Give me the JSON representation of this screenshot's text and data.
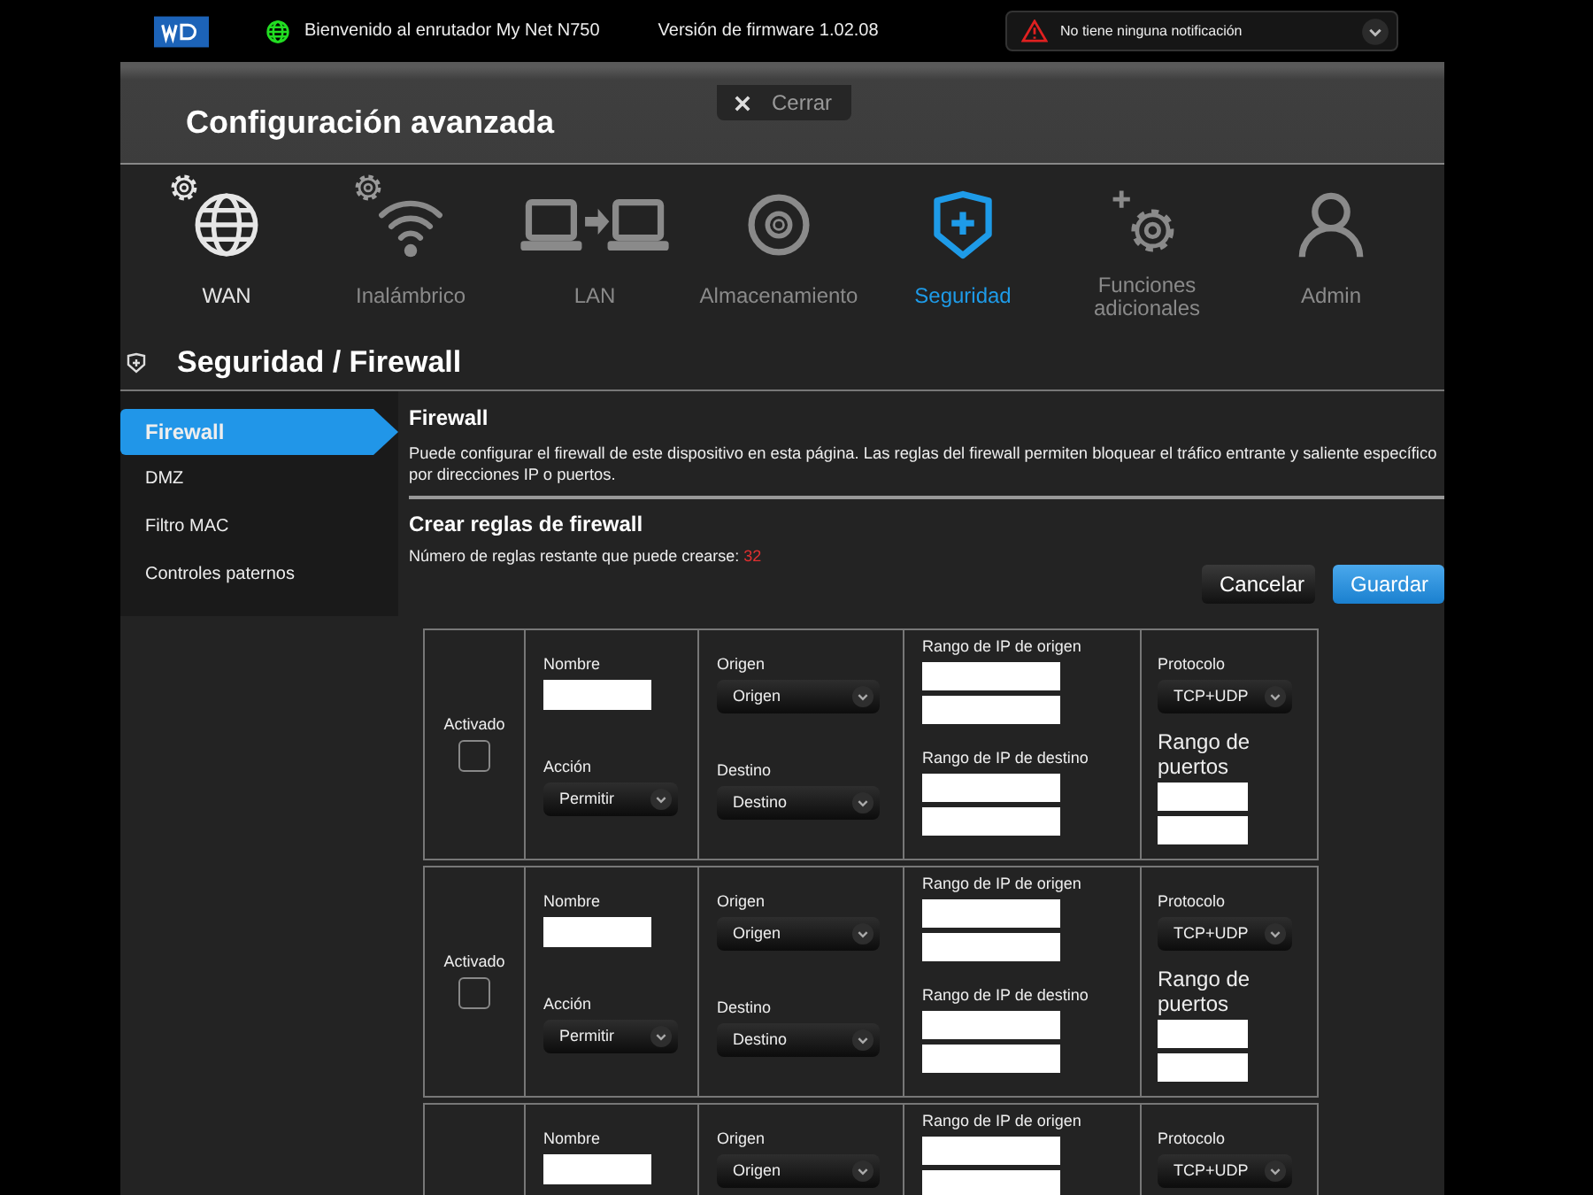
{
  "topbar": {
    "welcome": "Bienvenido al enrutador My Net N750",
    "firmware": "Versión de firmware 1.02.08",
    "notification": "No tiene ninguna notificación"
  },
  "header": {
    "close_label": "Cerrar",
    "title": "Configuración avanzada"
  },
  "nav": [
    {
      "kind": "wan",
      "label": "WAN",
      "selected": false,
      "highlighted": true,
      "gear_badge": true
    },
    {
      "kind": "wireless",
      "label": "Inalámbrico",
      "selected": false,
      "highlighted": false,
      "gear_badge": true
    },
    {
      "kind": "lan",
      "label": "LAN",
      "selected": false,
      "highlighted": false,
      "gear_badge": false
    },
    {
      "kind": "storage",
      "label": "Almacenamiento",
      "selected": false,
      "highlighted": false,
      "gear_badge": false
    },
    {
      "kind": "security",
      "label": "Seguridad",
      "selected": true,
      "highlighted": false,
      "gear_badge": false
    },
    {
      "kind": "extras",
      "label": "Funciones adicionales",
      "selected": false,
      "highlighted": false,
      "gear_badge": false
    },
    {
      "kind": "admin",
      "label": "Admin",
      "selected": false,
      "highlighted": false,
      "gear_badge": false
    }
  ],
  "section_title": "Seguridad / Firewall",
  "sidebar": [
    {
      "label": "Firewall",
      "selected": true
    },
    {
      "label": "DMZ",
      "selected": false
    },
    {
      "label": "Filtro MAC",
      "selected": false
    },
    {
      "label": "Controles paternos",
      "selected": false
    }
  ],
  "content": {
    "title": "Firewall",
    "description": "Puede configurar el firewall de este dispositivo en esta página. Las reglas del firewall permiten bloquear el tráfico entrante y saliente específico por direcciones IP o puertos.",
    "rules_title": "Crear reglas de firewall",
    "remaining_label": "Número de reglas restante que puede crearse:",
    "remaining_count": "32",
    "buttons": [
      {
        "kind": "secondary",
        "label": "Cancelar"
      },
      {
        "kind": "primary",
        "label": "Guardar"
      }
    ]
  },
  "rules": [
    {
      "enabled_label": "Activado",
      "enabled": false,
      "name_label": "Nombre",
      "action_label": "Acción",
      "action": "Permitir",
      "origin_label": "Origen",
      "origin": "Origen",
      "dest_label": "Destino",
      "dest": "Destino",
      "src_ip_label": "Rango de IP de origen",
      "dst_ip_label": "Rango de IP de destino",
      "protocol_label": "Protocolo",
      "protocol": "TCP+UDP",
      "ports_label": "Rango de puertos"
    },
    {
      "enabled_label": "Activado",
      "enabled": false,
      "name_label": "Nombre",
      "action_label": "Acción",
      "action": "Permitir",
      "origin_label": "Origen",
      "origin": "Origen",
      "dest_label": "Destino",
      "dest": "Destino",
      "src_ip_label": "Rango de IP de origen",
      "dst_ip_label": "Rango de IP de destino",
      "protocol_label": "Protocolo",
      "protocol": "TCP+UDP",
      "ports_label": "Rango de puertos"
    },
    {
      "name_label": "Nombre",
      "origin_label": "Origen",
      "origin": "Origen",
      "src_ip_label": "Rango de IP de origen",
      "protocol_label": "Protocolo",
      "protocol": "TCP+UDP"
    }
  ]
}
